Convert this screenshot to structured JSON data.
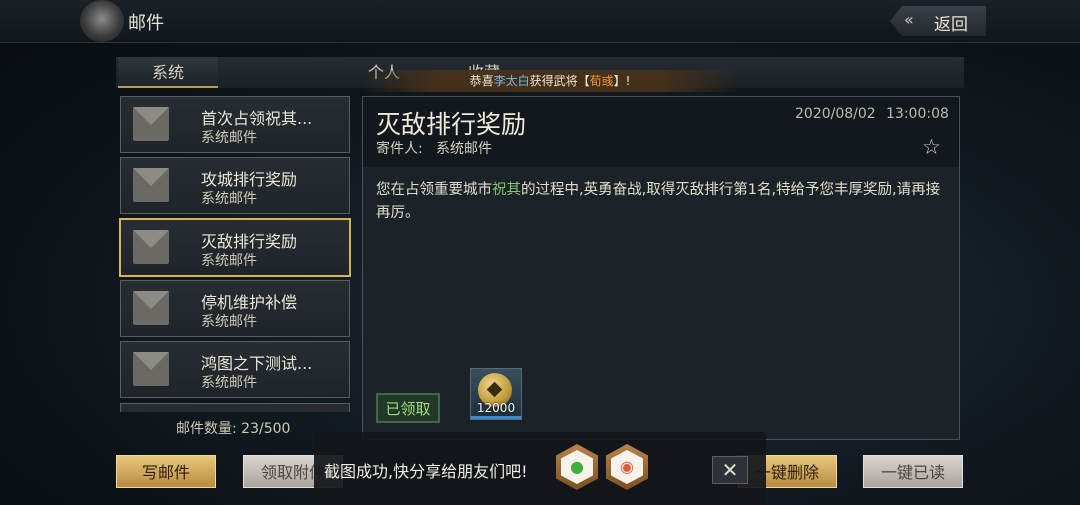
{
  "header": {
    "title": "邮件",
    "back_label": "返回"
  },
  "tabs": [
    {
      "label": "系统",
      "active": true
    },
    {
      "label": "个人",
      "active": false
    },
    {
      "label": "收藏",
      "active": false
    }
  ],
  "notice": {
    "prefix": "恭喜",
    "player": "李太白",
    "middle": "获得武将【",
    "general": "荀彧",
    "suffix": "】!"
  },
  "mail_list": [
    {
      "title": "首次占领祝其...",
      "subtitle": "系统邮件",
      "selected": false
    },
    {
      "title": "攻城排行奖励",
      "subtitle": "系统邮件",
      "selected": false
    },
    {
      "title": "灭敌排行奖励",
      "subtitle": "系统邮件",
      "selected": true
    },
    {
      "title": "停机维护补偿",
      "subtitle": "系统邮件",
      "selected": false
    },
    {
      "title": "鸿图之下测试...",
      "subtitle": "系统邮件",
      "selected": false
    }
  ],
  "mail_count": "邮件数量: 23/500",
  "detail": {
    "title": "灭敌排行奖励",
    "sender_label": "寄件人:",
    "sender": "系统邮件",
    "date": "2020/08/02",
    "time": "13:00:08",
    "body_part1": "您在占领重要城市",
    "body_highlight": "祝其",
    "body_part2": "的过程中,英勇奋战,取得灭敌排行第1名,特给予您丰厚奖励,请再接再厉。",
    "claimed_label": "已领取",
    "reward": {
      "icon": "copper-coin-icon",
      "amount": "12000"
    }
  },
  "buttons": {
    "write": "写邮件",
    "claim_attachments": "领取附件",
    "delete_all": "一键删除",
    "read_all": "一键已读"
  },
  "toast": {
    "text": "截图成功,快分享给朋友们吧!",
    "share_targets": [
      "wechat-icon",
      "camera-icon"
    ]
  },
  "colors": {
    "gold_accent": "#d6b25a",
    "highlight_green": "#84c46a",
    "notice_name": "#79b6e8",
    "notice_general": "#f09a3c"
  }
}
